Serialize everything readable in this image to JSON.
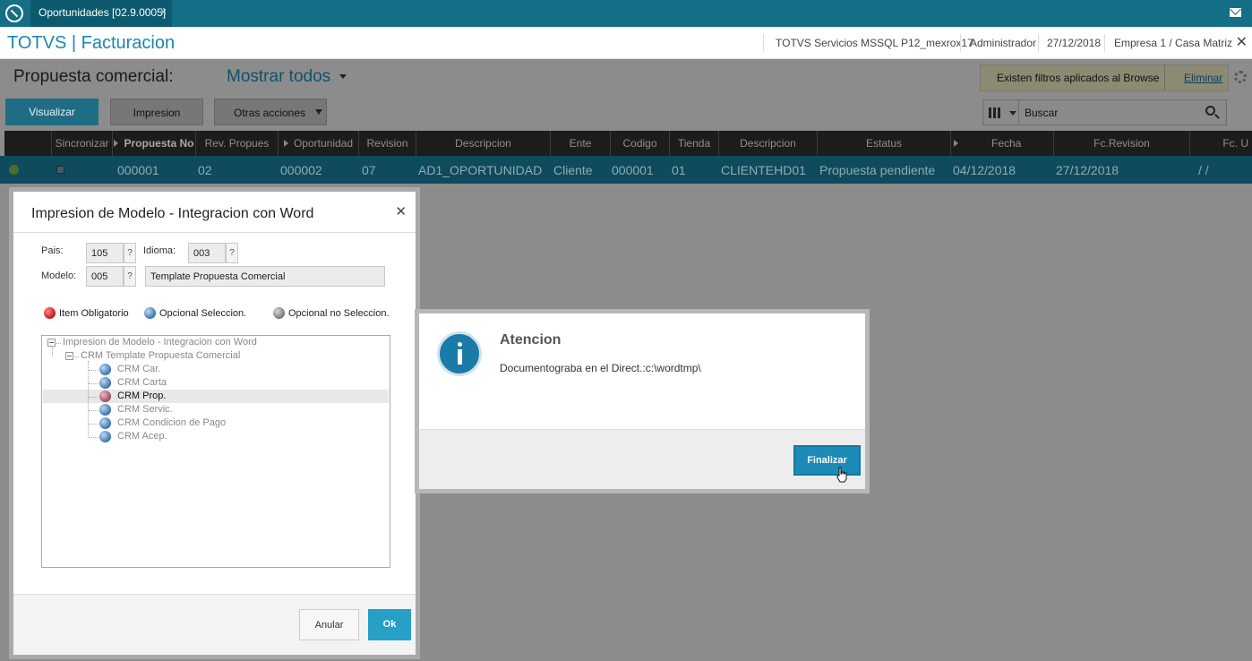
{
  "topbar": {
    "tab_label": "Oportunidades [02.9.0005]",
    "tab_close": "×"
  },
  "header": {
    "app_title": "TOTVS | Facturacion",
    "server": "TOTVS Servicios MSSQL P12_mexrox17",
    "user": "Administrador",
    "date": "27/12/2018",
    "company": "Empresa 1 / Casa Matriz",
    "close": "✕"
  },
  "browse": {
    "page_title": "Propuesta comercial:",
    "view_selector": "Mostrar todos",
    "filter_notice": "Existen filtros aplicados al Browse",
    "filter_remove": "Eliminar",
    "buttons": {
      "visualizar": "Visualizar",
      "impresion": "Impresion",
      "otras": "Otras acciones"
    },
    "search_placeholder": "Buscar",
    "columns": [
      "Sincronizar",
      "Propuesta No",
      "Rev. Propues",
      "Oportunidad",
      "Revision",
      "Descripcion",
      "Ente",
      "Codigo",
      "Tienda",
      "Descripcion",
      "Estatus",
      "Fecha",
      "Fc.Revision",
      "Fc. U"
    ],
    "row": [
      "000001",
      "02",
      "000002",
      "07",
      "AD1_OPORTUNIDAD",
      "Cliente",
      "000001",
      "01",
      "CLIENTEHD01",
      "Propuesta pendiente",
      "04/12/2018",
      "27/12/2018",
      "/ /"
    ]
  },
  "modal": {
    "title": "Impresion de Modelo - Integracion con Word",
    "close": "✕",
    "pais_label": "Pais:",
    "pais_value": "105",
    "idioma_label": "Idioma:",
    "idioma_value": "003",
    "modelo_label": "Modelo:",
    "modelo_value": "005",
    "modelo_desc": "Template Propuesta Comercial",
    "lookup": "?",
    "legend": {
      "obligatorio": "Item Obligatorio",
      "opcional_sel": "Opcional Seleccion.",
      "opcional_no": "Opcional no Seleccion."
    },
    "tree": {
      "root": "Impresion de Modelo - Integracion con Word",
      "group": "CRM Template Propuesta Comercial",
      "items": [
        "CRM Car.",
        "CRM Carta",
        "CRM Prop.",
        "CRM Servic.",
        "CRM Condicion de Pago",
        "CRM Acep."
      ]
    },
    "btn_anular": "Anular",
    "btn_ok": "Ok"
  },
  "alert": {
    "title": "Atencion",
    "message": "Documentograba en el Direct.:c:\\wordtmp\\",
    "btn_finalizar": "Finalizar"
  },
  "colors": {
    "topbar": "#146e85",
    "accent": "#1b86b3",
    "button_primary": "#27a0c8"
  },
  "icons": [
    "totvs-logo-icon",
    "mail-icon",
    "caret-down-icon",
    "gear-icon",
    "columns-icon",
    "search-icon",
    "info-icon",
    "hand-cursor-icon"
  ]
}
